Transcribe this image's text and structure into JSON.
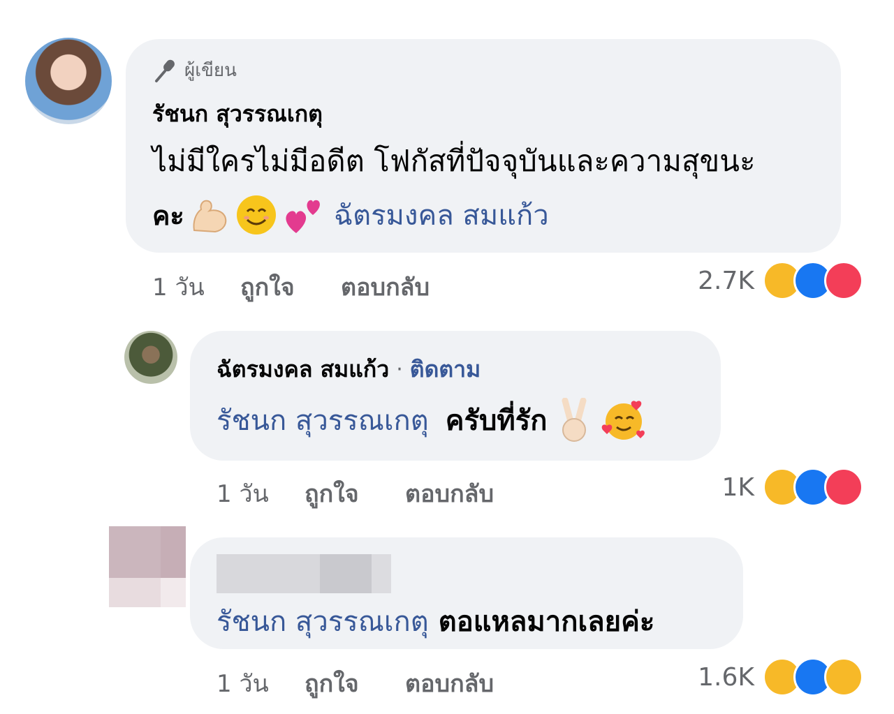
{
  "comment1": {
    "author_badge": "ผู้เขียน",
    "name": "รัชนก สุวรรณเกตุ",
    "text_line1": "ไม่มีใครไม่มีอดีต โฟกัสที่ปัจจุบันและความสุขนะ",
    "text_line2_prefix": "คะ",
    "emojis": [
      "flexed-biceps-emoji",
      "smiling-face-emoji",
      "two-hearts-emoji"
    ],
    "mention": "ฉัตรมงคล สมแก้ว",
    "time": "1 วัน",
    "like_label": "ถูกใจ",
    "reply_label": "ตอบกลับ",
    "reaction_count": "2.7K",
    "reactions": [
      "haha",
      "like",
      "love"
    ]
  },
  "comment2": {
    "name": "ฉัตรมงคล สมแก้ว",
    "separator": "·",
    "follow_label": "ติดตาม",
    "mention": "รัชนก สุวรรณเกตุ",
    "text": "ครับที่รัก",
    "emojis": [
      "victory-hand-emoji",
      "smiling-face-with-hearts-emoji"
    ],
    "time": "1 วัน",
    "like_label": "ถูกใจ",
    "reply_label": "ตอบกลับ",
    "reaction_count": "1K",
    "reactions": [
      "haha",
      "like",
      "love"
    ]
  },
  "comment3": {
    "mention": "รัชนก สุวรรณเกตุ",
    "text": "ตอแหลมากเลยค่ะ",
    "time": "1 วัน",
    "like_label": "ถูกใจ",
    "reply_label": "ตอบกลับ",
    "reaction_count": "1.6K",
    "reactions": [
      "haha",
      "like",
      "wow"
    ]
  },
  "colors": {
    "bubble": "#f0f2f5",
    "link": "#385898",
    "meta": "#65676b",
    "like": "#1877f2",
    "love": "#f33e58",
    "haha": "#f7b928"
  }
}
